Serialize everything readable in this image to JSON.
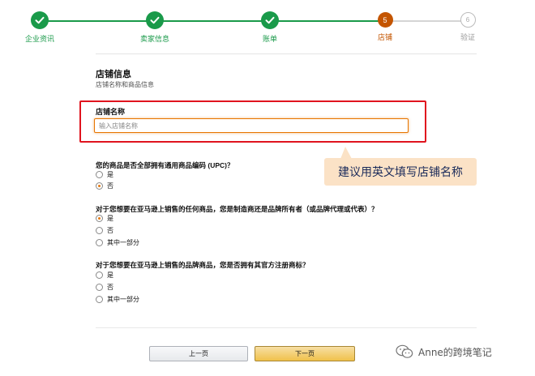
{
  "stepper": {
    "steps": [
      {
        "label": "企业资讯",
        "state": "done"
      },
      {
        "label": "卖家信息",
        "state": "done"
      },
      {
        "label": "账单",
        "state": "done"
      },
      {
        "label": "店铺",
        "state": "active",
        "number": "5"
      },
      {
        "label": "验证",
        "state": "todo",
        "number": "6"
      }
    ],
    "colors": {
      "done": "#1a9a4a",
      "active": "#c45500",
      "todo": "#bbbbbb"
    }
  },
  "section": {
    "title": "店铺信息",
    "subtitle": "店铺名称和商品信息"
  },
  "store_name": {
    "label": "店铺名称",
    "placeholder": "输入店铺名称",
    "value": ""
  },
  "questions": [
    {
      "text": "您的商品是否全部拥有通用商品编码 (UPC)？",
      "options": [
        {
          "label": "是",
          "checked": false
        },
        {
          "label": "否",
          "checked": true
        }
      ]
    },
    {
      "text": "对于您想要在亚马逊上销售的任何商品，您是制造商还是品牌所有者（或品牌代理或代表）？",
      "options": [
        {
          "label": "是",
          "checked": true
        },
        {
          "label": "否",
          "checked": false
        },
        {
          "label": "其中一部分",
          "checked": false
        }
      ]
    },
    {
      "text": "对于您想要在亚马逊上销售的品牌商品，您是否拥有其官方注册商标？",
      "options": [
        {
          "label": "是",
          "checked": false
        },
        {
          "label": "否",
          "checked": false
        },
        {
          "label": "其中一部分",
          "checked": false
        }
      ]
    }
  ],
  "buttons": {
    "prev": "上一页",
    "next": "下一页"
  },
  "callout": {
    "text": "建议用英文填写店铺名称",
    "highlight_color": "#e0141e"
  },
  "watermark": {
    "text": "Anne的跨境笔记",
    "icon": "wechat-icon"
  }
}
